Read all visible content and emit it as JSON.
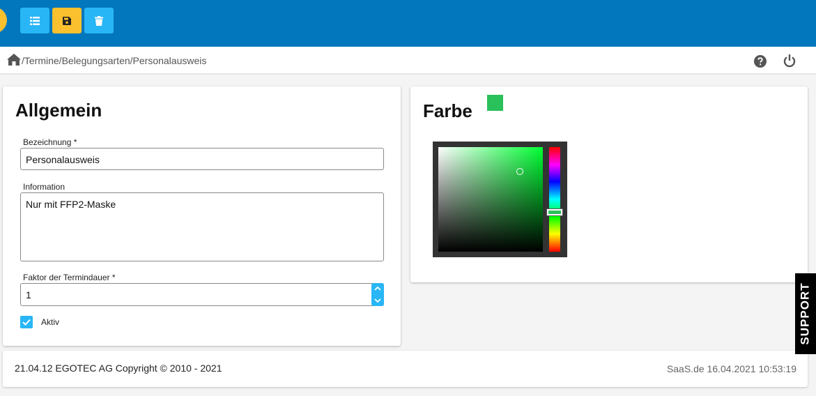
{
  "toolbar": {
    "list_icon": "list-icon",
    "save_icon": "save-icon",
    "delete_icon": "trash-icon"
  },
  "breadcrumb": {
    "path": "/Termine/Belegungsarten/Personalausweis",
    "home_icon": "home-icon"
  },
  "header_icons": [
    "help-icon",
    "power-icon"
  ],
  "general": {
    "title": "Allgemein",
    "name_label": "Bezeichnung  *",
    "name_value": "Personalausweis",
    "info_label": "Information",
    "info_value": "Nur mit FFP2-Maske",
    "factor_label": "Faktor der Termindauer  *",
    "factor_value": "1",
    "active_label": "Aktiv",
    "active_checked": true
  },
  "color": {
    "title": "Farbe",
    "selected_color": "#2ac05a"
  },
  "footer": {
    "left": "21.04.12 EGOTEC AG Copyright © 2010 - 2021",
    "right": "SaaS.de  16.04.2021 10:53:19"
  },
  "support_label": "SUPPORT",
  "colors": {
    "header_bg": "#0277bd",
    "accent_blue": "#29b6f6",
    "accent_yellow": "#fbc02d"
  }
}
